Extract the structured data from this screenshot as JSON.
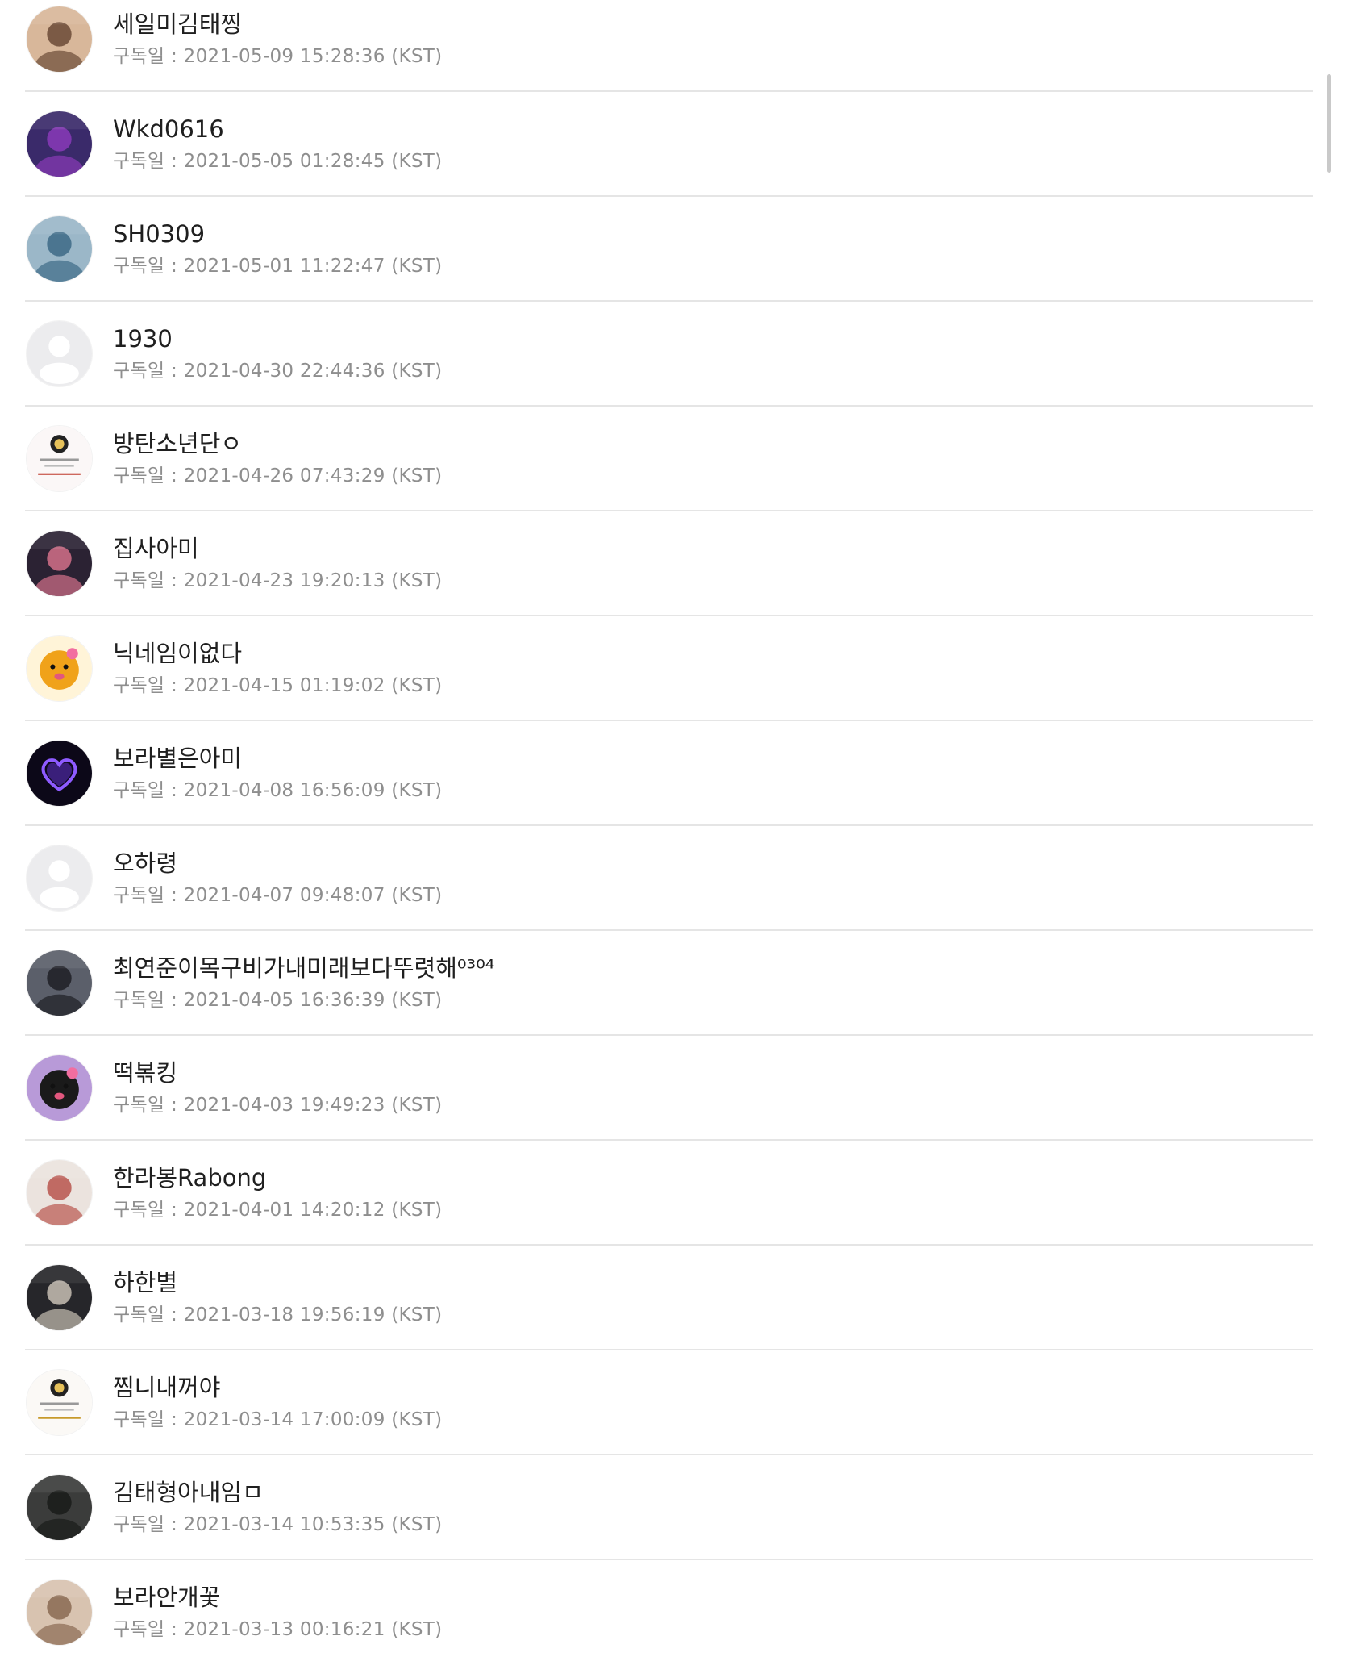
{
  "subscribers": [
    {
      "name": "세일미김태찡",
      "date": "구독일 : 2021-05-09 15:28:36 (KST)",
      "avatar": {
        "type": "photo",
        "icon": "person-photo-icon",
        "bg": "#d8b79a",
        "accent": "#6b4a36"
      }
    },
    {
      "name": "Wkd0616",
      "date": "구독일 : 2021-05-05 01:28:45 (KST)",
      "avatar": {
        "type": "photo",
        "icon": "stage-photo-icon",
        "bg": "#3a2a6a",
        "accent": "#8a3ab8"
      }
    },
    {
      "name": "SH0309",
      "date": "구독일 : 2021-05-01 11:22:47 (KST)",
      "avatar": {
        "type": "photo",
        "icon": "hand-photo-icon",
        "bg": "#9bb7c8",
        "accent": "#3d6a86"
      }
    },
    {
      "name": "1930",
      "date": "구독일 : 2021-04-30 22:44:36 (KST)",
      "avatar": {
        "type": "default",
        "icon": "default-profile-icon",
        "bg": "#ececee",
        "accent": "#ffffff"
      }
    },
    {
      "name": "방탄소년단ㅇ",
      "date": "구독일 : 2021-04-26 07:43:29 (KST)",
      "avatar": {
        "type": "card",
        "icon": "profile-card-icon",
        "bg": "#fbf7f7",
        "accent": "#c0392b"
      }
    },
    {
      "name": "집사아미",
      "date": "구독일 : 2021-04-23 19:20:13 (KST)",
      "avatar": {
        "type": "photo",
        "icon": "person-photo-icon",
        "bg": "#2b2233",
        "accent": "#d4708a"
      }
    },
    {
      "name": "닉네임이없다",
      "date": "구독일 : 2021-04-15 01:19:02 (KST)",
      "avatar": {
        "type": "character",
        "icon": "bear-character-icon",
        "bg": "#fff4d8",
        "accent": "#f0a21a"
      }
    },
    {
      "name": "보라별은아미",
      "date": "구독일 : 2021-04-08 16:56:09 (KST)",
      "avatar": {
        "type": "heart",
        "icon": "purple-heart-icon",
        "bg": "#0c0818",
        "accent": "#8e5bff"
      }
    },
    {
      "name": "오하령",
      "date": "구독일 : 2021-04-07 09:48:07 (KST)",
      "avatar": {
        "type": "default",
        "icon": "default-profile-icon",
        "bg": "#ececee",
        "accent": "#ffffff"
      }
    },
    {
      "name": "최연준이목구비가내미래보다뚜렷해⁰³⁰⁴",
      "date": "구독일 : 2021-04-05 16:36:39 (KST)",
      "avatar": {
        "type": "photo",
        "icon": "person-photo-icon",
        "bg": "#5b5f6a",
        "accent": "#1e1f25"
      }
    },
    {
      "name": "떡볶킹",
      "date": "구독일 : 2021-04-03 19:49:23 (KST)",
      "avatar": {
        "type": "character",
        "icon": "kuromi-character-icon",
        "bg": "#b89ad8",
        "accent": "#1a1a1a"
      }
    },
    {
      "name": "한라봉Rabong",
      "date": "구독일 : 2021-04-01 14:20:12 (KST)",
      "avatar": {
        "type": "photo",
        "icon": "cat-photo-icon",
        "bg": "#ebe3de",
        "accent": "#b9554e"
      }
    },
    {
      "name": "하한별",
      "date": "구독일 : 2021-03-18 19:56:19 (KST)",
      "avatar": {
        "type": "photo",
        "icon": "person-photo-icon",
        "bg": "#26262a",
        "accent": "#c8c0b4"
      }
    },
    {
      "name": "찜니내꺼야",
      "date": "구독일 : 2021-03-14 17:00:09 (KST)",
      "avatar": {
        "type": "card",
        "icon": "profile-card-icon",
        "bg": "#fbf9f6",
        "accent": "#c79a2b"
      }
    },
    {
      "name": "김태형아내임ㅁ",
      "date": "구독일 : 2021-03-14 10:53:35 (KST)",
      "avatar": {
        "type": "photo",
        "icon": "person-photo-icon",
        "bg": "#3b3c3b",
        "accent": "#1a1b1a"
      }
    },
    {
      "name": "보라안개꽃",
      "date": "구독일 : 2021-03-13 00:16:21 (KST)",
      "avatar": {
        "type": "photo",
        "icon": "cat-photo-icon",
        "bg": "#d8c3b0",
        "accent": "#8a6a52"
      }
    }
  ]
}
